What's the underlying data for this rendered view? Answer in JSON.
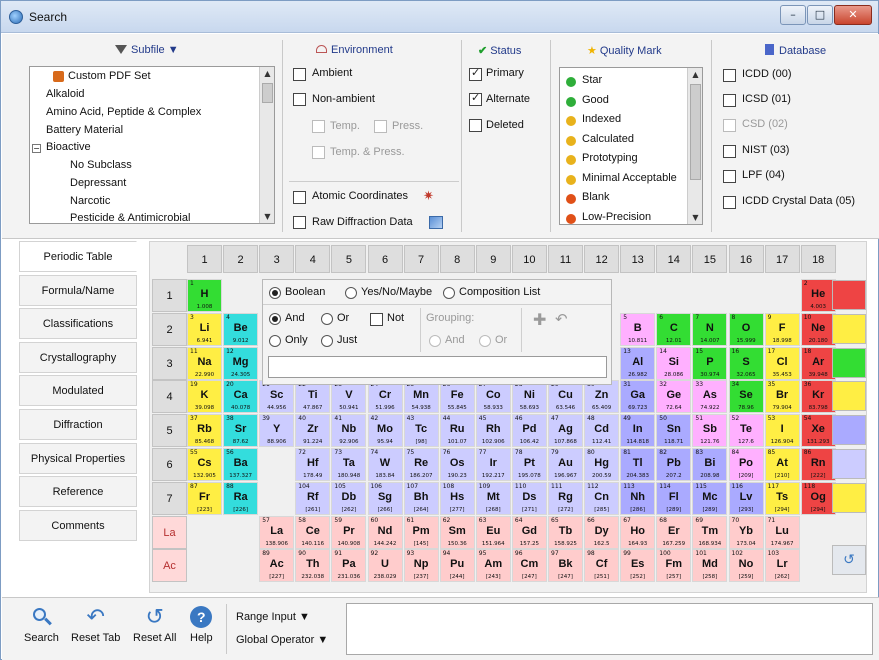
{
  "window": {
    "title": "Search",
    "min": "–",
    "max": "□",
    "close": "✕"
  },
  "filters": {
    "subfile": {
      "title": "Subfile ▼",
      "items": [
        "Custom PDF Set",
        "Alkaloid",
        "Amino Acid, Peptide & Complex",
        "Battery Material",
        "Bioactive",
        "No Subclass",
        "Depressant",
        "Narcotic",
        "Pesticide & Antimicrobial"
      ]
    },
    "environment": {
      "title": "Environment",
      "ambient": "Ambient",
      "non_ambient": "Non-ambient",
      "temp": "Temp.",
      "press": "Press.",
      "temp_press": "Temp. & Press.",
      "atomic": "Atomic Coordinates",
      "raw": "Raw Diffraction Data"
    },
    "status": {
      "title": "Status",
      "primary": "Primary",
      "alternate": "Alternate",
      "deleted": "Deleted"
    },
    "quality": {
      "title": "Quality Mark",
      "items": [
        {
          "label": "Star",
          "color": "#2fae3a"
        },
        {
          "label": "Good",
          "color": "#2fae3a"
        },
        {
          "label": "Indexed",
          "color": "#e8b21c"
        },
        {
          "label": "Calculated",
          "color": "#e8b21c"
        },
        {
          "label": "Prototyping",
          "color": "#e8b21c"
        },
        {
          "label": "Minimal Acceptable",
          "color": "#e8b21c"
        },
        {
          "label": "Blank",
          "color": "#e05018"
        },
        {
          "label": "Low-Precision",
          "color": "#e05018"
        }
      ]
    },
    "database": {
      "title": "Database",
      "items": [
        "ICDD (00)",
        "ICSD (01)",
        "CSD (02)",
        "NIST (03)",
        "LPF (04)",
        "ICDD Crystal Data (05)"
      ]
    }
  },
  "tabs": [
    "Periodic Table",
    "Formula/Name",
    "Classifications",
    "Crystallography",
    "Modulated",
    "Diffraction",
    "Physical Properties",
    "Reference",
    "Comments"
  ],
  "groups": [
    "1",
    "2",
    "3",
    "4",
    "5",
    "6",
    "7",
    "8",
    "9",
    "10",
    "11",
    "12",
    "13",
    "14",
    "15",
    "16",
    "17",
    "18"
  ],
  "periods": [
    "1",
    "2",
    "3",
    "4",
    "5",
    "6",
    "7",
    "La",
    "Ac"
  ],
  "overlay": {
    "boolean": "Boolean",
    "yesno": "Yes/No/Maybe",
    "complist": "Composition List",
    "and": "And",
    "or": "Or",
    "not": "Not",
    "only": "Only",
    "just": "Just",
    "grouping": "Grouping:",
    "g_and": "And",
    "g_or": "Or"
  },
  "elements": [
    [
      "H",
      "1",
      "1.008",
      0,
      0,
      "#33dd33"
    ],
    [
      "He",
      "2",
      "4.003",
      17,
      0,
      "#ee4444"
    ],
    [
      "Li",
      "3",
      "6.941",
      0,
      1,
      "#ffee44"
    ],
    [
      "Be",
      "4",
      "9.012",
      1,
      1,
      "#33dddd"
    ],
    [
      "B",
      "5",
      "10.811",
      12,
      1,
      "#ffb0ff"
    ],
    [
      "C",
      "6",
      "12.01",
      13,
      1,
      "#33dd33"
    ],
    [
      "N",
      "7",
      "14.007",
      14,
      1,
      "#33dd33"
    ],
    [
      "O",
      "8",
      "15.999",
      15,
      1,
      "#33dd33"
    ],
    [
      "F",
      "9",
      "18.998",
      16,
      1,
      "#ffee44"
    ],
    [
      "Ne",
      "10",
      "20.180",
      17,
      1,
      "#ee4444"
    ],
    [
      "Na",
      "11",
      "22.990",
      0,
      2,
      "#ffee44"
    ],
    [
      "Mg",
      "12",
      "24.305",
      1,
      2,
      "#33dddd"
    ],
    [
      "Al",
      "13",
      "26.982",
      12,
      2,
      "#aaaaff"
    ],
    [
      "Si",
      "14",
      "28.086",
      13,
      2,
      "#ffb0ff"
    ],
    [
      "P",
      "15",
      "30.974",
      14,
      2,
      "#33dd33"
    ],
    [
      "S",
      "16",
      "32.065",
      15,
      2,
      "#33dd33"
    ],
    [
      "Cl",
      "17",
      "35.453",
      16,
      2,
      "#ffee44"
    ],
    [
      "Ar",
      "18",
      "39.948",
      17,
      2,
      "#ee4444"
    ],
    [
      "K",
      "19",
      "39.098",
      0,
      3,
      "#ffee44"
    ],
    [
      "Ca",
      "20",
      "40.078",
      1,
      3,
      "#33dddd"
    ],
    [
      "Sc",
      "21",
      "44.956",
      2,
      3,
      "#ccccff"
    ],
    [
      "Ti",
      "22",
      "47.867",
      3,
      3,
      "#ccccff"
    ],
    [
      "V",
      "23",
      "50.941",
      4,
      3,
      "#ccccff"
    ],
    [
      "Cr",
      "24",
      "51.996",
      5,
      3,
      "#ccccff"
    ],
    [
      "Mn",
      "25",
      "54.938",
      6,
      3,
      "#ccccff"
    ],
    [
      "Fe",
      "26",
      "55.845",
      7,
      3,
      "#ccccff"
    ],
    [
      "Co",
      "27",
      "58.933",
      8,
      3,
      "#ccccff"
    ],
    [
      "Ni",
      "28",
      "58.693",
      9,
      3,
      "#ccccff"
    ],
    [
      "Cu",
      "29",
      "63.546",
      10,
      3,
      "#ccccff"
    ],
    [
      "Zn",
      "30",
      "65.409",
      11,
      3,
      "#ccccff"
    ],
    [
      "Ga",
      "31",
      "69.723",
      12,
      3,
      "#aaaaff"
    ],
    [
      "Ge",
      "32",
      "72.64",
      13,
      3,
      "#ffb0ff"
    ],
    [
      "As",
      "33",
      "74.922",
      14,
      3,
      "#ffb0ff"
    ],
    [
      "Se",
      "34",
      "78.96",
      15,
      3,
      "#33dd33"
    ],
    [
      "Br",
      "35",
      "79.904",
      16,
      3,
      "#ffee44"
    ],
    [
      "Kr",
      "36",
      "83.798",
      17,
      3,
      "#ee4444"
    ],
    [
      "Rb",
      "37",
      "85.468",
      0,
      4,
      "#ffee44"
    ],
    [
      "Sr",
      "38",
      "87.62",
      1,
      4,
      "#33dddd"
    ],
    [
      "Y",
      "39",
      "88.906",
      2,
      4,
      "#ccccff"
    ],
    [
      "Zr",
      "40",
      "91.224",
      3,
      4,
      "#ccccff"
    ],
    [
      "Nb",
      "41",
      "92.906",
      4,
      4,
      "#ccccff"
    ],
    [
      "Mo",
      "42",
      "95.94",
      5,
      4,
      "#ccccff"
    ],
    [
      "Tc",
      "43",
      "[98]",
      6,
      4,
      "#ccccff"
    ],
    [
      "Ru",
      "44",
      "101.07",
      7,
      4,
      "#ccccff"
    ],
    [
      "Rh",
      "45",
      "102.906",
      8,
      4,
      "#ccccff"
    ],
    [
      "Pd",
      "46",
      "106.42",
      9,
      4,
      "#ccccff"
    ],
    [
      "Ag",
      "47",
      "107.868",
      10,
      4,
      "#ccccff"
    ],
    [
      "Cd",
      "48",
      "112.41",
      11,
      4,
      "#ccccff"
    ],
    [
      "In",
      "49",
      "114.818",
      12,
      4,
      "#aaaaff"
    ],
    [
      "Sn",
      "50",
      "118.71",
      13,
      4,
      "#aaaaff"
    ],
    [
      "Sb",
      "51",
      "121.76",
      14,
      4,
      "#ffb0ff"
    ],
    [
      "Te",
      "52",
      "127.6",
      15,
      4,
      "#ffb0ff"
    ],
    [
      "I",
      "53",
      "126.904",
      16,
      4,
      "#ffee44"
    ],
    [
      "Xe",
      "54",
      "131.293",
      17,
      4,
      "#ee4444"
    ],
    [
      "Cs",
      "55",
      "132.905",
      0,
      5,
      "#ffee44"
    ],
    [
      "Ba",
      "56",
      "137.327",
      1,
      5,
      "#33dddd"
    ],
    [
      "Hf",
      "72",
      "178.49",
      3,
      5,
      "#ccccff"
    ],
    [
      "Ta",
      "73",
      "180.948",
      4,
      5,
      "#ccccff"
    ],
    [
      "W",
      "74",
      "183.84",
      5,
      5,
      "#ccccff"
    ],
    [
      "Re",
      "75",
      "186.207",
      6,
      5,
      "#ccccff"
    ],
    [
      "Os",
      "76",
      "190.23",
      7,
      5,
      "#ccccff"
    ],
    [
      "Ir",
      "77",
      "192.217",
      8,
      5,
      "#ccccff"
    ],
    [
      "Pt",
      "78",
      "195.078",
      9,
      5,
      "#ccccff"
    ],
    [
      "Au",
      "79",
      "196.967",
      10,
      5,
      "#ccccff"
    ],
    [
      "Hg",
      "80",
      "200.59",
      11,
      5,
      "#ccccff"
    ],
    [
      "Tl",
      "81",
      "204.383",
      12,
      5,
      "#aaaaff"
    ],
    [
      "Pb",
      "82",
      "207.2",
      13,
      5,
      "#aaaaff"
    ],
    [
      "Bi",
      "83",
      "208.98",
      14,
      5,
      "#aaaaff"
    ],
    [
      "Po",
      "84",
      "[209]",
      15,
      5,
      "#ffb0ff"
    ],
    [
      "At",
      "85",
      "[210]",
      16,
      5,
      "#ffee44"
    ],
    [
      "Rn",
      "86",
      "[222]",
      17,
      5,
      "#ee4444"
    ],
    [
      "Fr",
      "87",
      "[223]",
      0,
      6,
      "#ffee44"
    ],
    [
      "Ra",
      "88",
      "[226]",
      1,
      6,
      "#33dddd"
    ],
    [
      "Rf",
      "104",
      "[261]",
      3,
      6,
      "#ccccff"
    ],
    [
      "Db",
      "105",
      "[262]",
      4,
      6,
      "#ccccff"
    ],
    [
      "Sg",
      "106",
      "[266]",
      5,
      6,
      "#ccccff"
    ],
    [
      "Bh",
      "107",
      "[264]",
      6,
      6,
      "#ccccff"
    ],
    [
      "Hs",
      "108",
      "[277]",
      7,
      6,
      "#ccccff"
    ],
    [
      "Mt",
      "109",
      "[268]",
      8,
      6,
      "#ccccff"
    ],
    [
      "Ds",
      "110",
      "[271]",
      9,
      6,
      "#ccccff"
    ],
    [
      "Rg",
      "111",
      "[272]",
      10,
      6,
      "#ccccff"
    ],
    [
      "Cn",
      "112",
      "[285]",
      11,
      6,
      "#ccccff"
    ],
    [
      "Nh",
      "113",
      "[286]",
      12,
      6,
      "#aaaaff"
    ],
    [
      "Fl",
      "114",
      "[289]",
      13,
      6,
      "#aaaaff"
    ],
    [
      "Mc",
      "115",
      "[289]",
      14,
      6,
      "#aaaaff"
    ],
    [
      "Lv",
      "116",
      "[293]",
      15,
      6,
      "#aaaaff"
    ],
    [
      "Ts",
      "117",
      "[294]",
      16,
      6,
      "#ffee44"
    ],
    [
      "Og",
      "118",
      "[294]",
      17,
      6,
      "#ee4444"
    ],
    [
      "La",
      "57",
      "138.906",
      2,
      7,
      "#ffcccc"
    ],
    [
      "Ce",
      "58",
      "140.116",
      3,
      7,
      "#ffcccc"
    ],
    [
      "Pr",
      "59",
      "140.908",
      4,
      7,
      "#ffcccc"
    ],
    [
      "Nd",
      "60",
      "144.242",
      5,
      7,
      "#ffcccc"
    ],
    [
      "Pm",
      "61",
      "[145]",
      6,
      7,
      "#ffcccc"
    ],
    [
      "Sm",
      "62",
      "150.36",
      7,
      7,
      "#ffcccc"
    ],
    [
      "Eu",
      "63",
      "151.964",
      8,
      7,
      "#ffcccc"
    ],
    [
      "Gd",
      "64",
      "157.25",
      9,
      7,
      "#ffcccc"
    ],
    [
      "Tb",
      "65",
      "158.925",
      10,
      7,
      "#ffcccc"
    ],
    [
      "Dy",
      "66",
      "162.5",
      11,
      7,
      "#ffcccc"
    ],
    [
      "Ho",
      "67",
      "164.93",
      12,
      7,
      "#ffcccc"
    ],
    [
      "Er",
      "68",
      "167.259",
      13,
      7,
      "#ffcccc"
    ],
    [
      "Tm",
      "69",
      "168.934",
      14,
      7,
      "#ffcccc"
    ],
    [
      "Yb",
      "70",
      "173.04",
      15,
      7,
      "#ffcccc"
    ],
    [
      "Lu",
      "71",
      "174.967",
      16,
      7,
      "#ffcccc"
    ],
    [
      "Ac",
      "89",
      "[227]",
      2,
      8,
      "#ffcccc"
    ],
    [
      "Th",
      "90",
      "232.038",
      3,
      8,
      "#ffcccc"
    ],
    [
      "Pa",
      "91",
      "231.036",
      4,
      8,
      "#ffcccc"
    ],
    [
      "U",
      "92",
      "238.029",
      5,
      8,
      "#ffcccc"
    ],
    [
      "Np",
      "93",
      "[237]",
      6,
      8,
      "#ffcccc"
    ],
    [
      "Pu",
      "94",
      "[244]",
      7,
      8,
      "#ffcccc"
    ],
    [
      "Am",
      "95",
      "[243]",
      8,
      8,
      "#ffcccc"
    ],
    [
      "Cm",
      "96",
      "[247]",
      9,
      8,
      "#ffcccc"
    ],
    [
      "Bk",
      "97",
      "[247]",
      10,
      8,
      "#ffcccc"
    ],
    [
      "Cf",
      "98",
      "[251]",
      11,
      8,
      "#ffcccc"
    ],
    [
      "Es",
      "99",
      "[252]",
      12,
      8,
      "#ffcccc"
    ],
    [
      "Fm",
      "100",
      "[257]",
      13,
      8,
      "#ffcccc"
    ],
    [
      "Md",
      "101",
      "[258]",
      14,
      8,
      "#ffcccc"
    ],
    [
      "No",
      "102",
      "[259]",
      15,
      8,
      "#ffcccc"
    ],
    [
      "Lr",
      "103",
      "[262]",
      16,
      8,
      "#ffcccc"
    ]
  ],
  "swatches": [
    "#ee4444",
    "#ffee44",
    "#33dd33",
    "#ffee44",
    "#aaaaff",
    "#ccccff",
    "#ffee44"
  ],
  "bottom": {
    "search": "Search",
    "reset_tab": "Reset Tab",
    "reset_all": "Reset All",
    "help": "Help",
    "range": "Range Input ▼",
    "global": "Global Operator ▼"
  }
}
